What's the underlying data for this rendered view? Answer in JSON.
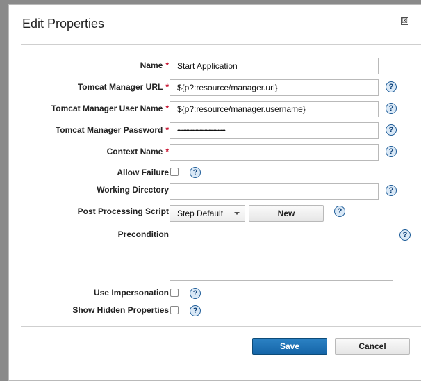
{
  "dialog": {
    "title": "Edit Properties",
    "close_glyph": "☒"
  },
  "required_marker": "*",
  "help_glyph": "?",
  "fields": {
    "name": {
      "label": "Name",
      "value": "Start Application",
      "required": true
    },
    "manager_url": {
      "label": "Tomcat Manager URL",
      "value": "${p?:resource/manager.url}",
      "required": true
    },
    "manager_user": {
      "label": "Tomcat Manager User Name",
      "value": "${p?:resource/manager.username}",
      "required": true
    },
    "manager_password": {
      "label": "Tomcat Manager Password",
      "value": "••••••••••••••••••••••••••••••••",
      "required": true
    },
    "context_name": {
      "label": "Context Name",
      "value": "",
      "required": true
    },
    "allow_failure": {
      "label": "Allow Failure",
      "checked": false
    },
    "working_directory": {
      "label": "Working Directory",
      "value": ""
    },
    "post_processing": {
      "label": "Post Processing Script",
      "selected": "Step Default",
      "new_label": "New"
    },
    "precondition": {
      "label": "Precondition",
      "value": ""
    },
    "use_impersonation": {
      "label": "Use Impersonation",
      "checked": false
    },
    "show_hidden": {
      "label": "Show Hidden Properties",
      "checked": false
    }
  },
  "buttons": {
    "save": "Save",
    "cancel": "Cancel"
  },
  "colors": {
    "required": "#c8102e",
    "save_button": "#1a6eb0",
    "help_icon": "#1f5d99"
  }
}
